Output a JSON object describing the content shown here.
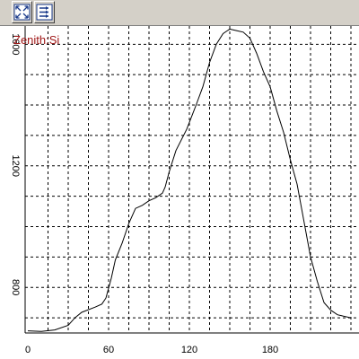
{
  "toolbar": {
    "buttons": [
      {
        "icon": "fit-view-icon"
      },
      {
        "icon": "options-list-icon"
      }
    ]
  },
  "colors": {
    "plot_line": "#000000",
    "grid": "#000000",
    "series_label": "#a01818",
    "toolbar_bg": "#d4d0c8"
  },
  "chart_data": {
    "type": "line",
    "title": "",
    "xlabel": "",
    "ylabel": "",
    "series": [
      {
        "name": "Zenith:Si",
        "x": [
          0,
          10,
          20,
          30,
          35,
          40,
          50,
          55,
          58,
          62,
          65,
          70,
          75,
          80,
          85,
          90,
          95,
          100,
          102,
          105,
          110,
          118,
          125,
          130,
          135,
          140,
          145,
          150,
          155,
          160,
          165,
          170,
          175,
          180,
          185,
          190,
          195,
          200,
          205,
          210,
          215,
          220,
          225,
          230,
          240
        ],
        "y": [
          657,
          655,
          660,
          675,
          700,
          718,
          735,
          745,
          765,
          830,
          890,
          945,
          1010,
          1060,
          1070,
          1085,
          1095,
          1110,
          1130,
          1180,
          1250,
          1320,
          1400,
          1460,
          1540,
          1600,
          1635,
          1650,
          1645,
          1640,
          1620,
          1570,
          1510,
          1460,
          1380,
          1310,
          1220,
          1140,
          1020,
          900,
          820,
          750,
          725,
          710,
          700
        ]
      }
    ],
    "x_ticks": [
      "0",
      "60",
      "120",
      "180"
    ],
    "y_ticks": [
      "800",
      "1200",
      "1600"
    ],
    "xlim": [
      -2,
      246
    ],
    "ylim": [
      650,
      1660
    ],
    "grid": true,
    "legend": "top-left"
  }
}
